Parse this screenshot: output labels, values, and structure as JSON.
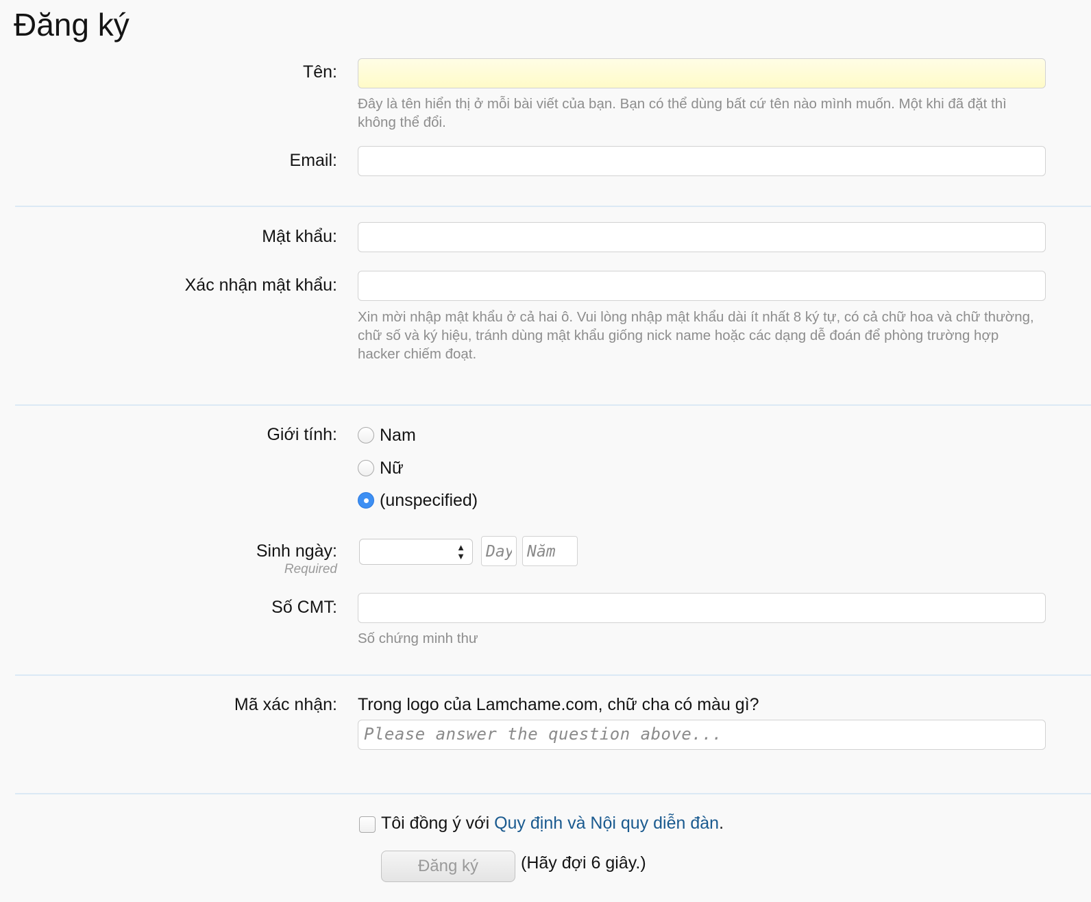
{
  "page": {
    "title": "Đăng ký"
  },
  "name_field": {
    "label": "Tên:",
    "value": "",
    "hint": "Đây là tên hiển thị ở mỗi bài viết của bạn. Bạn có thể dùng bất cứ tên nào mình muốn. Một khi đã đặt thì không thể đổi."
  },
  "email_field": {
    "label": "Email:",
    "value": ""
  },
  "password_field": {
    "label": "Mật khẩu:",
    "value": ""
  },
  "confirm_password_field": {
    "label": "Xác nhận mật khẩu:",
    "value": "",
    "hint": "Xin mời nhập mật khẩu ở cả hai ô. Vui lòng nhập mật khẩu dài ít nhất 8 ký tự, có cả chữ hoa và chữ thường, chữ số và ký hiệu, tránh dùng mật khẩu giống nick name hoặc các dạng dễ đoán để phòng trường hợp hacker chiếm đoạt."
  },
  "gender": {
    "label": "Giới tính:",
    "options": [
      "Nam",
      "Nữ",
      "(unspecified)"
    ],
    "selected": "(unspecified)"
  },
  "birthday": {
    "label": "Sinh ngày:",
    "required_note": "Required",
    "month_value": "",
    "day_placeholder": "Day",
    "year_placeholder": "Năm"
  },
  "id_number": {
    "label": "Số CMT:",
    "value": "",
    "hint": "Số chứng minh thư"
  },
  "captcha": {
    "label": "Mã xác nhận:",
    "question": "Trong logo của Lamchame.com, chữ cha có màu gì?",
    "placeholder": "Please answer the question above..."
  },
  "agreement": {
    "checked": false,
    "prefix": "Tôi đồng ý với ",
    "link_text": "Quy định và Nội quy diễn đàn",
    "suffix": "."
  },
  "submit": {
    "label": "Đăng ký",
    "wait_text": "(Hãy đợi 6 giây.)"
  },
  "colors": {
    "background": "#f9f9f9",
    "link": "#1a5a8f",
    "divider": "#dbe9f5",
    "radio_checked": "#3d8ff3",
    "hint_text": "#8d8d8d"
  }
}
